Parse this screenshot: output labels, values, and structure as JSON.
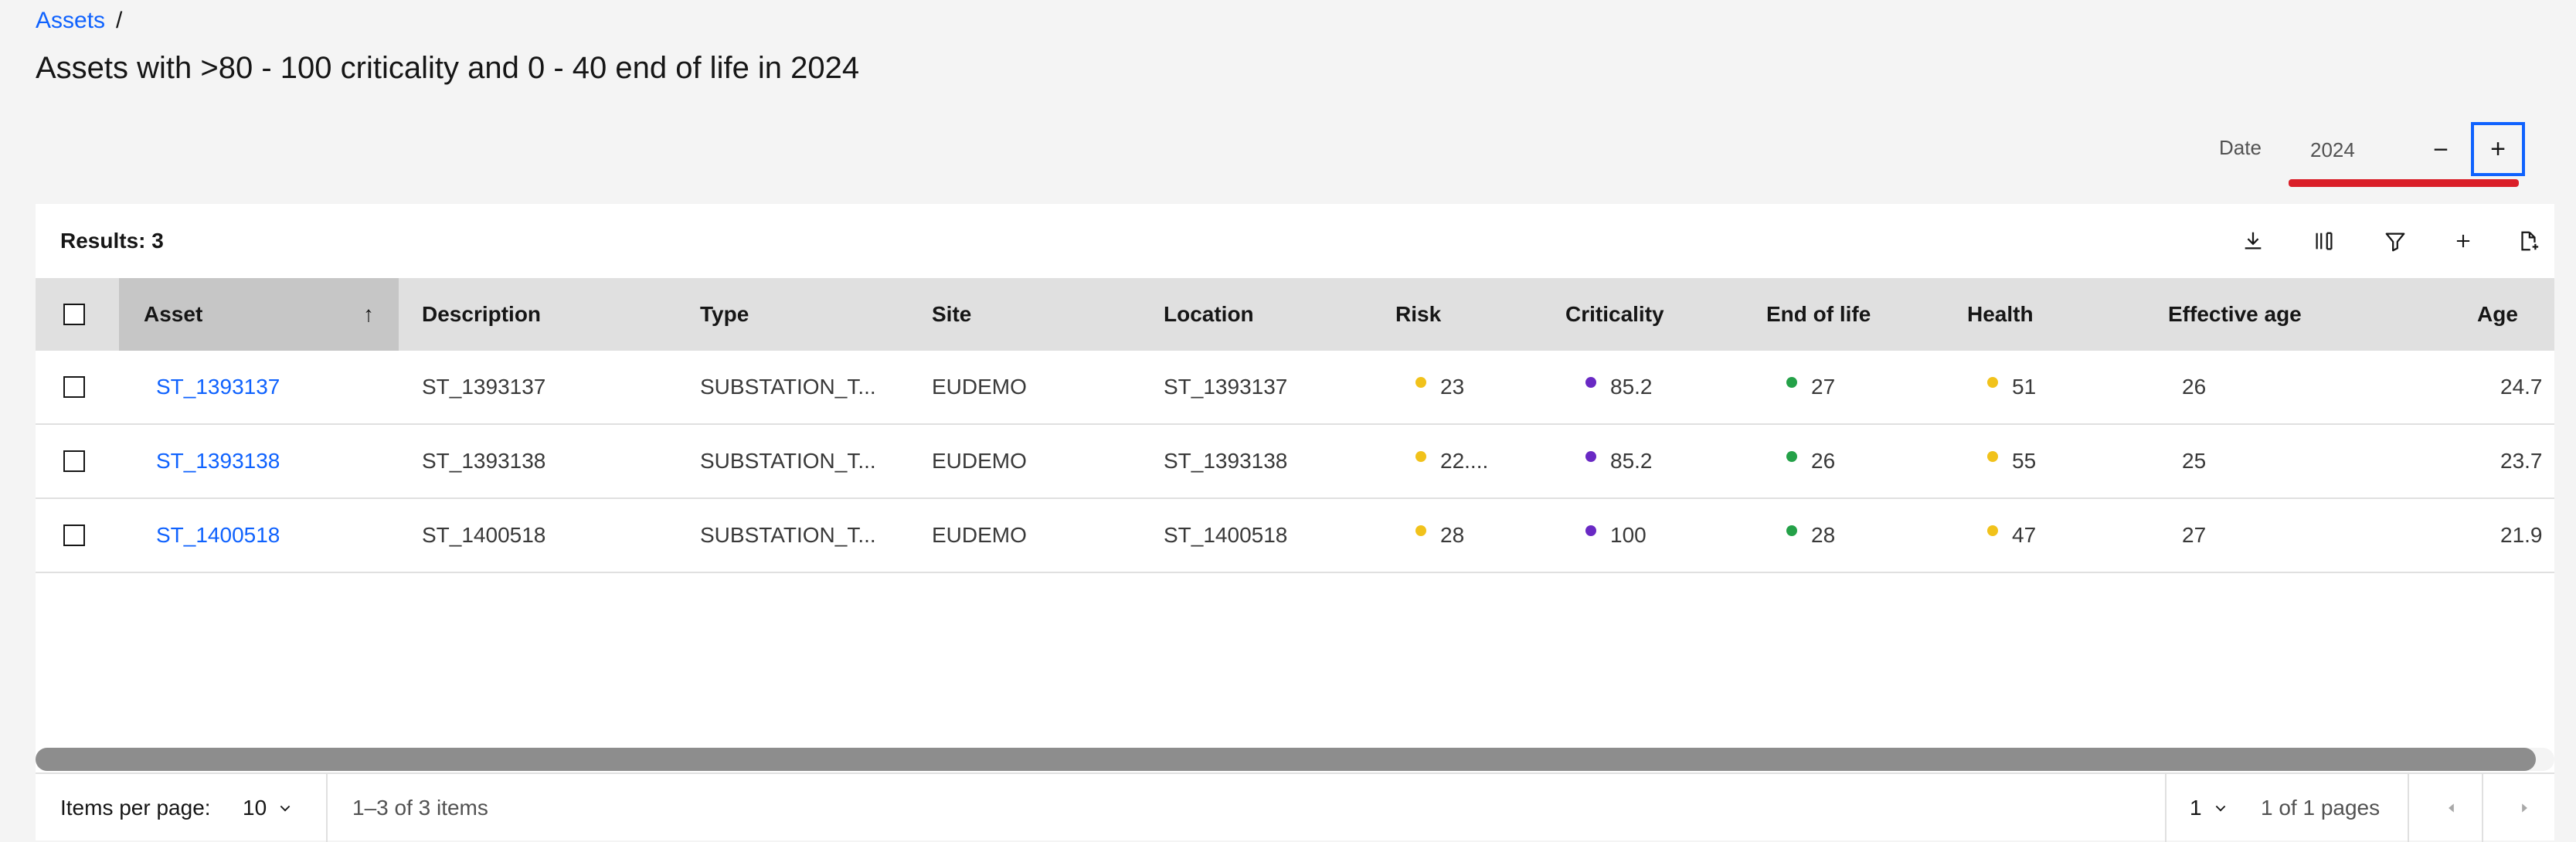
{
  "breadcrumb": {
    "link": "Assets",
    "sep": "/"
  },
  "page_title": "Assets with >80 - 100 criticality and 0 - 40 end of life in 2024",
  "date": {
    "label": "Date",
    "value": "2024",
    "minus": "−",
    "plus": "+"
  },
  "results_label": "Results: 3",
  "toolbar": [
    "download-icon",
    "columns-icon",
    "filter-icon",
    "add-icon",
    "export-icon"
  ],
  "columns": [
    "Asset",
    "Description",
    "Type",
    "Site",
    "Location",
    "Risk",
    "Criticality",
    "End of life",
    "Health",
    "Effective age",
    "Age"
  ],
  "sort_indicator": "↑",
  "rows": [
    {
      "asset": "ST_1393137",
      "description": "ST_1393137",
      "type": "SUBSTATION_T...",
      "site": "EUDEMO",
      "location": "ST_1393137",
      "risk": "23",
      "criticality": "85.2",
      "end_of_life": "27",
      "health": "51",
      "effective_age": "26",
      "age": "24.7"
    },
    {
      "asset": "ST_1393138",
      "description": "ST_1393138",
      "type": "SUBSTATION_T...",
      "site": "EUDEMO",
      "location": "ST_1393138",
      "risk": "22....",
      "criticality": "85.2",
      "end_of_life": "26",
      "health": "55",
      "effective_age": "25",
      "age": "23.7"
    },
    {
      "asset": "ST_1400518",
      "description": "ST_1400518",
      "type": "SUBSTATION_T...",
      "site": "EUDEMO",
      "location": "ST_1400518",
      "risk": "28",
      "criticality": "100",
      "end_of_life": "28",
      "health": "47",
      "effective_age": "27",
      "age": "21.9"
    }
  ],
  "status_colors": {
    "risk": "#f1c21b",
    "criticality": "#6929c4",
    "end_of_life": "#24a148",
    "health": "#f1c21b"
  },
  "footer": {
    "items_per_page_label": "Items per page:",
    "items_per_page_value": "10",
    "range_text": "1–3 of 3 items",
    "page_value": "1",
    "pages_text": "1 of 1 pages"
  }
}
